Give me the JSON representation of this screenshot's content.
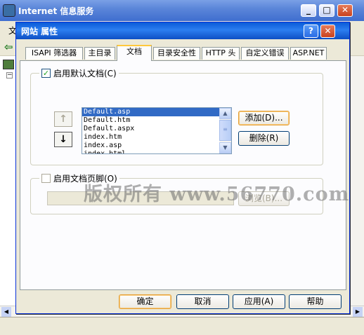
{
  "background_window": {
    "title": "Internet 信息服务",
    "menu_first": "文",
    "minimize": "_",
    "maximize": "□",
    "close": "✕"
  },
  "dialog": {
    "title": "网站 属性",
    "help_label": "?",
    "close_label": "✕"
  },
  "tabs": [
    {
      "label": "ISAPI 筛选器",
      "active": false
    },
    {
      "label": "主目录",
      "active": false
    },
    {
      "label": "文档",
      "active": true
    },
    {
      "label": "目录安全性",
      "active": false
    },
    {
      "label": "HTTP 头",
      "active": false
    },
    {
      "label": "自定义错误",
      "active": false
    },
    {
      "label": "ASP.NET",
      "active": false
    }
  ],
  "default_doc": {
    "checkbox_label": "启用默认文档(C)",
    "checked": true,
    "up_arrow": "↑",
    "down_arrow": "↓",
    "documents": [
      "Default.asp",
      "Default.htm",
      "Default.aspx",
      "index.htm",
      "index.asp",
      "index.html"
    ],
    "selected_index": 0,
    "add_label": "添加(D)...",
    "delete_label": "删除(R)"
  },
  "footer_doc": {
    "checkbox_label": "启用文档页脚(O)",
    "checked": false,
    "browse_label": "浏览(B)..."
  },
  "watermark": "版权所有 www.56770.com",
  "buttons": {
    "ok": "确定",
    "cancel": "取消",
    "apply": "应用(A)",
    "help": "帮助"
  }
}
